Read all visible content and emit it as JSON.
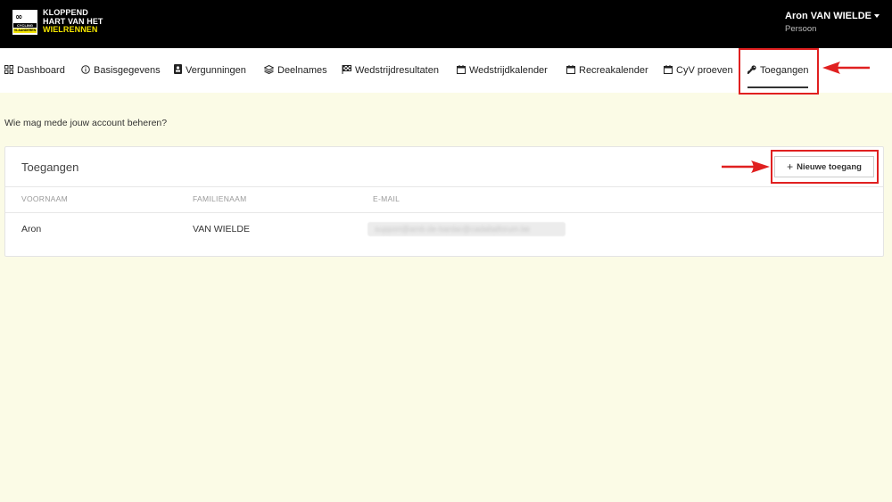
{
  "brand": {
    "badge_glyph": "∞",
    "badge_word_1": "CYCLING",
    "badge_word_2": "VLAANDEREN",
    "line1": "KLOPPEND",
    "line2": "HART VAN HET",
    "line3": "WIELRENNEN",
    "accent_color": "#f5e600"
  },
  "user": {
    "name": "Aron VAN WIELDE",
    "role": "Persoon"
  },
  "nav": {
    "items": [
      {
        "label": "Dashboard",
        "icon": "grid-icon"
      },
      {
        "label": "Basisgegevens",
        "icon": "info-circle-icon"
      },
      {
        "label": "Vergunningen",
        "icon": "id-card-icon"
      },
      {
        "label": "Deelnames",
        "icon": "layers-icon"
      },
      {
        "label": "Wedstrijdresultaten",
        "icon": "checkered-flag-icon"
      },
      {
        "label": "Wedstrijdkalender",
        "icon": "calendar-icon"
      },
      {
        "label": "Recreakalender",
        "icon": "calendar-icon"
      },
      {
        "label": "CyV proeven",
        "icon": "calendar-icon"
      },
      {
        "label": "Toegangen",
        "icon": "key-icon",
        "active": true
      }
    ]
  },
  "page": {
    "intro": "Wie mag mede jouw account beheren?"
  },
  "card": {
    "title": "Toegangen",
    "new_button_label": "Nieuwe toegang",
    "columns": [
      "VOORNAAM",
      "FAMILIENAAM",
      "E-MAIL"
    ],
    "rows": [
      {
        "voornaam": "Aron",
        "familienaam": "VAN WIELDE",
        "email": "support@amb.de-bardar@cadaltalforum.be"
      }
    ]
  },
  "annotation_color": "#e02020"
}
